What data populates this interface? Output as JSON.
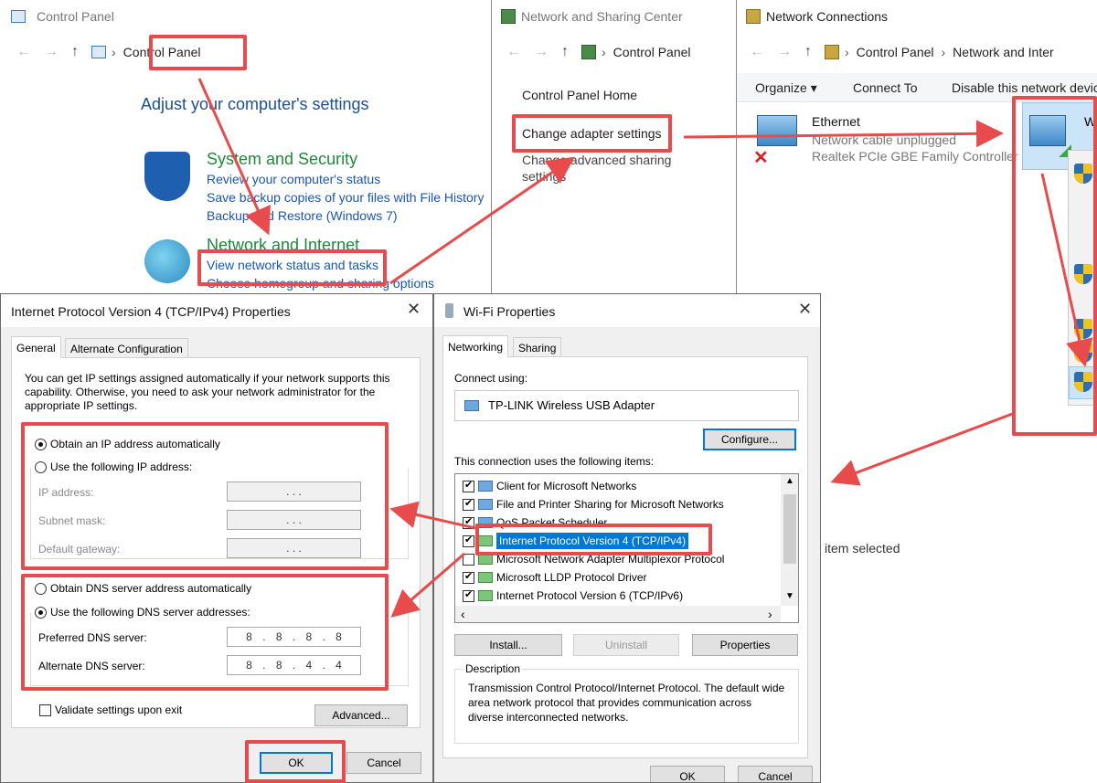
{
  "control_panel": {
    "title": "Control Panel",
    "breadcrumb": "Control Panel",
    "heading": "Adjust your computer's settings",
    "system_security": {
      "title": "System and Security",
      "links": [
        "Review your computer's status",
        "Save backup copies of your files with File History",
        "Backup and Restore (Windows 7)"
      ]
    },
    "network_internet": {
      "title": "Network and Internet",
      "links": [
        "View network status and tasks",
        "Choose homegroup and sharing options"
      ]
    }
  },
  "sharing_center": {
    "title": "Network and Sharing Center",
    "breadcrumb": "Control Panel",
    "links": [
      "Control Panel Home",
      "Change adapter settings",
      "Change advanced sharing settings"
    ]
  },
  "network_connections": {
    "title": "Network Connections",
    "breadcrumb_1": "Control Panel",
    "breadcrumb_2": "Network and Inter",
    "toolbar": [
      "Organize ▾",
      "Connect To",
      "Disable this network devic"
    ],
    "ethernet": {
      "name": "Ethernet",
      "status": "Network cable unplugged",
      "adapter": "Realtek PCIe GBE Family Controller"
    },
    "wifi_letter": "W",
    "status_bar": "item selected"
  },
  "ipv4_dialog": {
    "title": "Internet Protocol Version 4 (TCP/IPv4) Properties",
    "tabs": [
      "General",
      "Alternate Configuration"
    ],
    "description": "You can get IP settings assigned automatically if your network supports this capability. Otherwise, you need to ask your network administrator for the appropriate IP settings.",
    "ip_auto": "Obtain an IP address automatically",
    "ip_manual": "Use the following IP address:",
    "ip_label": "IP address:",
    "subnet_label": "Subnet mask:",
    "gateway_label": "Default gateway:",
    "empty_ip": ". . .",
    "dns_auto": "Obtain DNS server address automatically",
    "dns_manual": "Use the following DNS server addresses:",
    "preferred_label": "Preferred DNS server:",
    "preferred_value": "8 . 8 . 8 . 8",
    "alternate_label": "Alternate DNS server:",
    "alternate_value": "8 . 8 . 4 . 4",
    "validate": "Validate settings upon exit",
    "advanced": "Advanced...",
    "ok": "OK",
    "cancel": "Cancel"
  },
  "wifi_dialog": {
    "title": "Wi-Fi Properties",
    "tabs": [
      "Networking",
      "Sharing"
    ],
    "connect_using": "Connect using:",
    "adapter": "TP-LINK Wireless USB Adapter",
    "configure": "Configure...",
    "items_label": "This connection uses the following items:",
    "items": [
      "Client for Microsoft Networks",
      "File and Printer Sharing for Microsoft Networks",
      "QoS Packet Scheduler",
      "Internet Protocol Version 4 (TCP/IPv4)",
      "Microsoft Network Adapter Multiplexor Protocol",
      "Microsoft LLDP Protocol Driver",
      "Internet Protocol Version 6 (TCP/IPv6)"
    ],
    "install": "Install...",
    "uninstall": "Uninstall",
    "properties": "Properties",
    "description_label": "Description",
    "description": "Transmission Control Protocol/Internet Protocol. The default wide area network protocol that provides communication across diverse interconnected networks.",
    "ok": "OK",
    "cancel": "Cancel"
  },
  "colors": {
    "accent": "#e84b4b",
    "link": "#1a56b0",
    "heading_green": "#1e8a3a",
    "selection": "#0078d7"
  }
}
